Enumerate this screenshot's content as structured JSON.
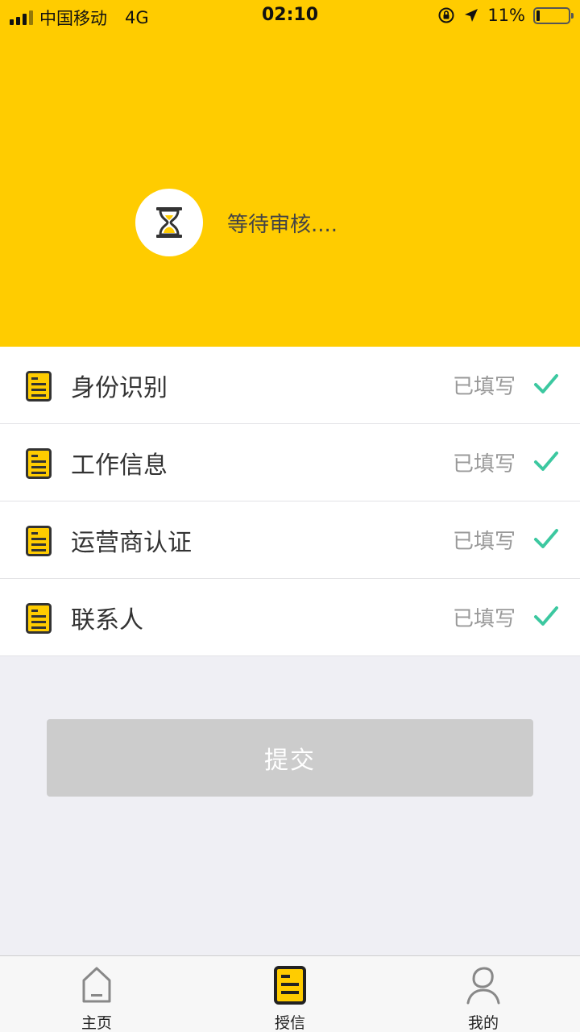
{
  "status_bar": {
    "carrier": "中国移动",
    "network": "4G",
    "time": "02:10",
    "battery": "11%"
  },
  "review": {
    "icon": "hourglass-icon",
    "text": "等待审核...."
  },
  "items": [
    {
      "label": "身份识别",
      "status": "已填写",
      "icon": "document-icon"
    },
    {
      "label": "工作信息",
      "status": "已填写",
      "icon": "document-icon"
    },
    {
      "label": "运营商认证",
      "status": "已填写",
      "icon": "document-icon"
    },
    {
      "label": "联系人",
      "status": "已填写",
      "icon": "document-icon"
    }
  ],
  "submit_label": "提交",
  "tabs": [
    {
      "label": "主页",
      "icon": "home-icon",
      "active": false
    },
    {
      "label": "授信",
      "icon": "credit-document-icon",
      "active": true
    },
    {
      "label": "我的",
      "icon": "profile-icon",
      "active": false
    }
  ],
  "colors": {
    "accent": "#ffcc00",
    "check": "#3cc8a0",
    "disabled_button": "#cccccc",
    "background": "#efeff4"
  }
}
